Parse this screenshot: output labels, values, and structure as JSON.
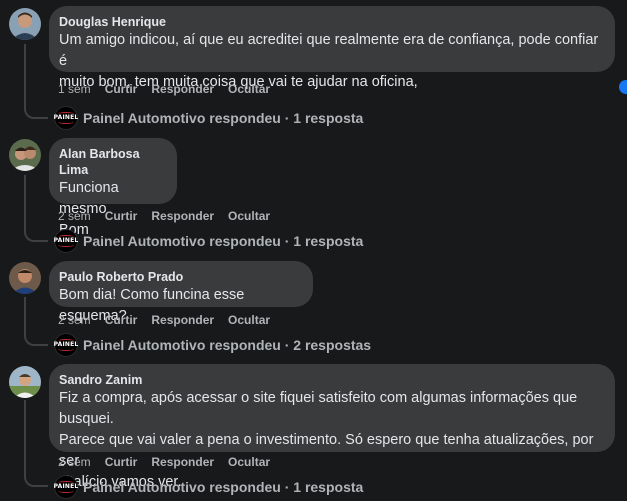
{
  "comments": [
    {
      "author": "Douglas Henrique",
      "text": "Um amigo indicou, aí que eu acreditei que realmente era de confiança, pode confiar é\nmuito bom, tem muita coisa que vai te ajudar na oficina,",
      "time": "1 sem",
      "like": "Curtir",
      "reply": "Responder",
      "hide": "Ocultar",
      "reply_summary": "Painel Automotivo respondeu · 1 resposta"
    },
    {
      "author": "Alan Barbosa Lima",
      "text": "Funciona mesmo\nBom",
      "time": "2 sem",
      "like": "Curtir",
      "reply": "Responder",
      "hide": "Ocultar",
      "reply_summary": "Painel Automotivo respondeu · 1 resposta"
    },
    {
      "author": "Paulo Roberto Prado",
      "text": "Bom dia! Como funcina esse esquema?",
      "time": "2 sem",
      "like": "Curtir",
      "reply": "Responder",
      "hide": "Ocultar",
      "reply_summary": "Painel Automotivo respondeu · 2 respostas"
    },
    {
      "author": "Sandro Zanim",
      "text": "Fiz a compra, após acessar o site fiquei satisfeito com algumas informações que busquei.\nParece que vai valer a pena o investimento. Só espero que tenha atualizações, por ser\nvitalício vamos ver.",
      "time": "2 sem",
      "like": "Curtir",
      "reply": "Responder",
      "hide": "Ocultar",
      "reply_summary": "Painel Automotivo respondeu · 1 resposta"
    }
  ],
  "page_logo_text": "PAINEL",
  "colors": {
    "background": "#18191a",
    "bubble": "#3a3b3c",
    "text": "#e4e6eb",
    "secondary": "#b0b3b8",
    "logo_red": "#c0282e"
  }
}
